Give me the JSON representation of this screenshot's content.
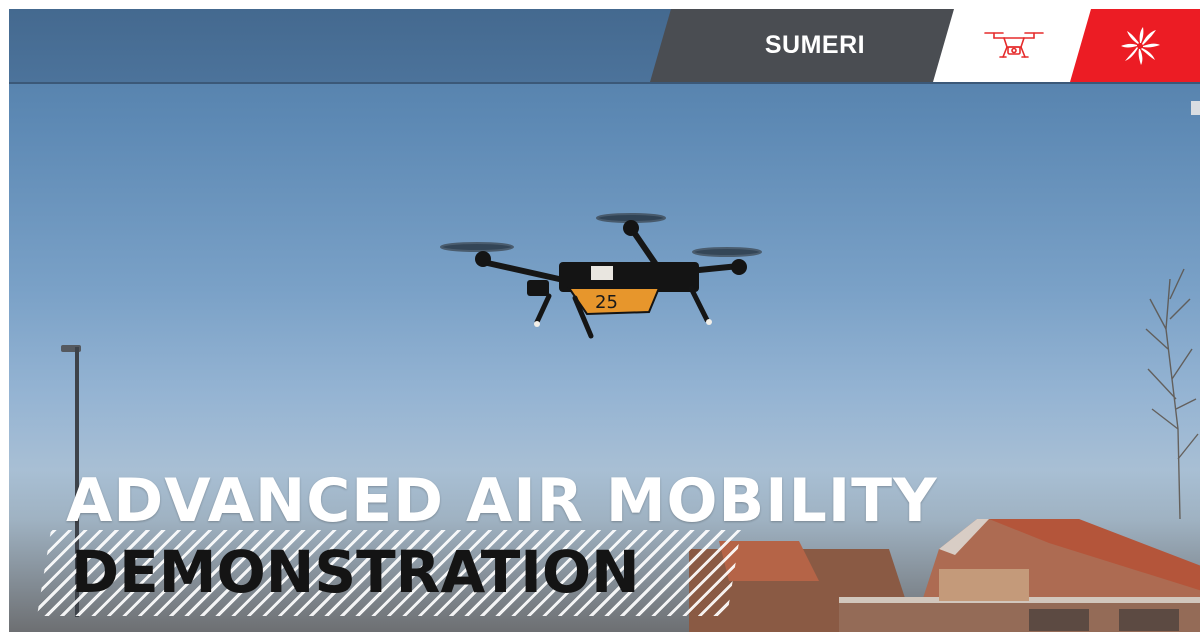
{
  "header": {
    "brand_label": "SUMERI",
    "drone_logo": "drone-icon",
    "partner_logo": "partner-burst-logo",
    "colors": {
      "dark": "#4a4d52",
      "white": "#ffffff",
      "red": "#ec1c24"
    }
  },
  "hero": {
    "title_line_1": "ADVANCED AIR MOBILITY",
    "title_line_2": "DEMONSTRATION",
    "drone_marking": "25"
  }
}
